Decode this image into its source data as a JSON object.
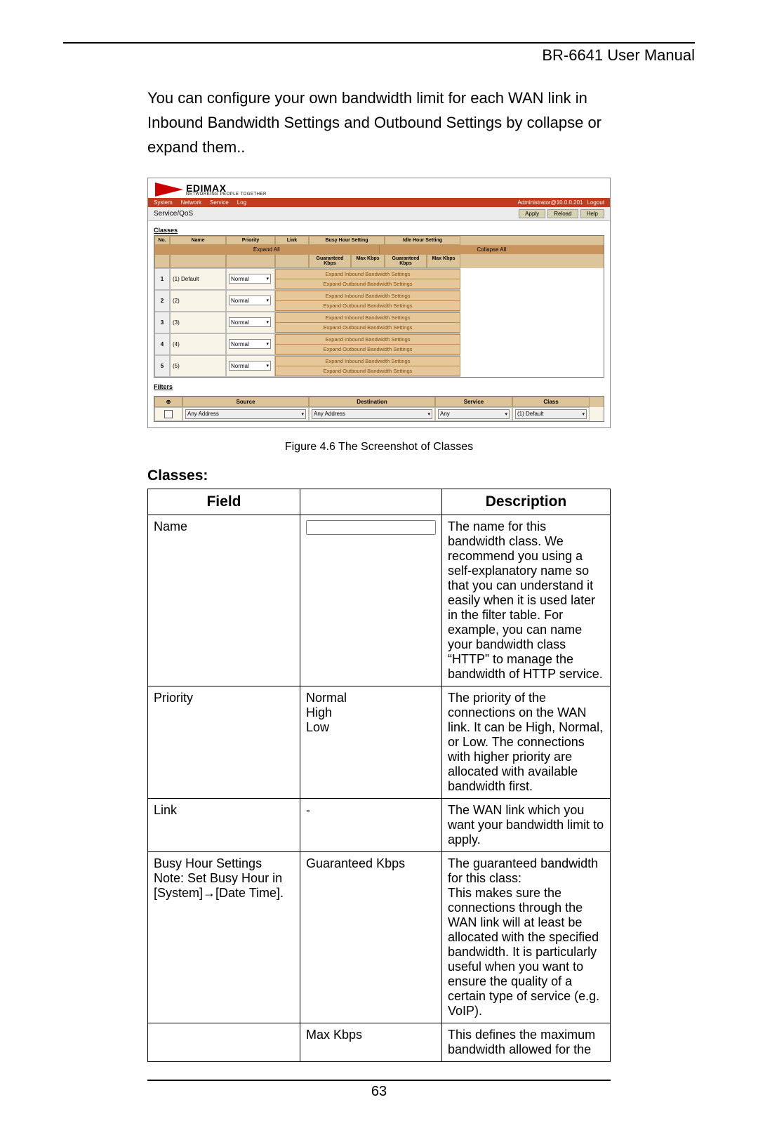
{
  "header": {
    "title": "BR-6641 User Manual"
  },
  "intro_text": "You can configure your own bandwidth limit for each WAN link in Inbound Bandwidth Settings and Outbound Settings by collapse or expand them..",
  "screenshot": {
    "brand": "EDIMAX",
    "brand_sub": "NETWORKING PEOPLE TOGETHER",
    "nav": [
      "System",
      "Network",
      "Service",
      "Log"
    ],
    "nav_user": "Administrator@10.0.0.201",
    "nav_logout": "Logout",
    "breadcrumb": "Service/QoS",
    "buttons": [
      "Apply",
      "Reload",
      "Help"
    ],
    "classes_title": "Classes",
    "expand_all": "Expand All",
    "collapse_all": "Collapse All",
    "col": {
      "no": "No.",
      "name": "Name",
      "priority": "Priority",
      "link": "Link",
      "busy": "Busy Hour Setting",
      "idle": "Idle Hour Setting",
      "g_kbps": "Guaranteed Kbps",
      "m_kbps": "Max Kbps"
    },
    "priority_value": "Normal",
    "rows": [
      {
        "no": "1",
        "name": "(1) Default"
      },
      {
        "no": "2",
        "name": "(2)"
      },
      {
        "no": "3",
        "name": "(3)"
      },
      {
        "no": "4",
        "name": "(4)"
      },
      {
        "no": "5",
        "name": "(5)"
      }
    ],
    "exp_in": "Expand Inbound Bandwidth Settings",
    "exp_out": "Expand Outbound Bandwidth Settings",
    "filters_title": "Filters",
    "filters_head": {
      "chk": "",
      "source": "Source",
      "dest": "Destination",
      "service": "Service",
      "class": "Class"
    },
    "filters_row": {
      "source": "Any Address",
      "dest": "Any Address",
      "service": "Any",
      "class": "(1) Default"
    }
  },
  "figure_caption": "Figure 4.6 The Screenshot of Classes",
  "classes_heading": "Classes:",
  "desc_table": {
    "head": {
      "field": "Field",
      "value": "",
      "desc": "Description"
    },
    "rows": [
      {
        "field": "Name",
        "value": "<Input name>",
        "desc": "The name for this bandwidth class. We recommend you using a self-explanatory name so that you can understand it easily when it is used later in the filter table. For example, you can name your bandwidth class “HTTP” to manage the bandwidth of HTTP service."
      },
      {
        "field": "Priority",
        "value": "Normal\nHigh\nLow",
        "desc": "The priority of the connections on the WAN link. It can be High, Normal, or Low. The connections with higher priority are allocated with available bandwidth first."
      },
      {
        "field": "Link",
        "value": "-",
        "desc": "The WAN link which you want your bandwidth limit to apply."
      },
      {
        "field": "Busy Hour Settings\nNote: Set Busy Hour in [System]→[Date Time].",
        "value": "Guaranteed Kbps",
        "desc": "The guaranteed bandwidth for this class:\nThis makes sure the connections through the WAN link will at least be allocated with the specified bandwidth. It is particularly useful when you want to ensure the quality of a certain type of service (e.g. VoIP)."
      },
      {
        "field": "",
        "value": "Max Kbps",
        "desc": "This defines the maximum bandwidth allowed for the"
      }
    ]
  },
  "page_number": "63"
}
